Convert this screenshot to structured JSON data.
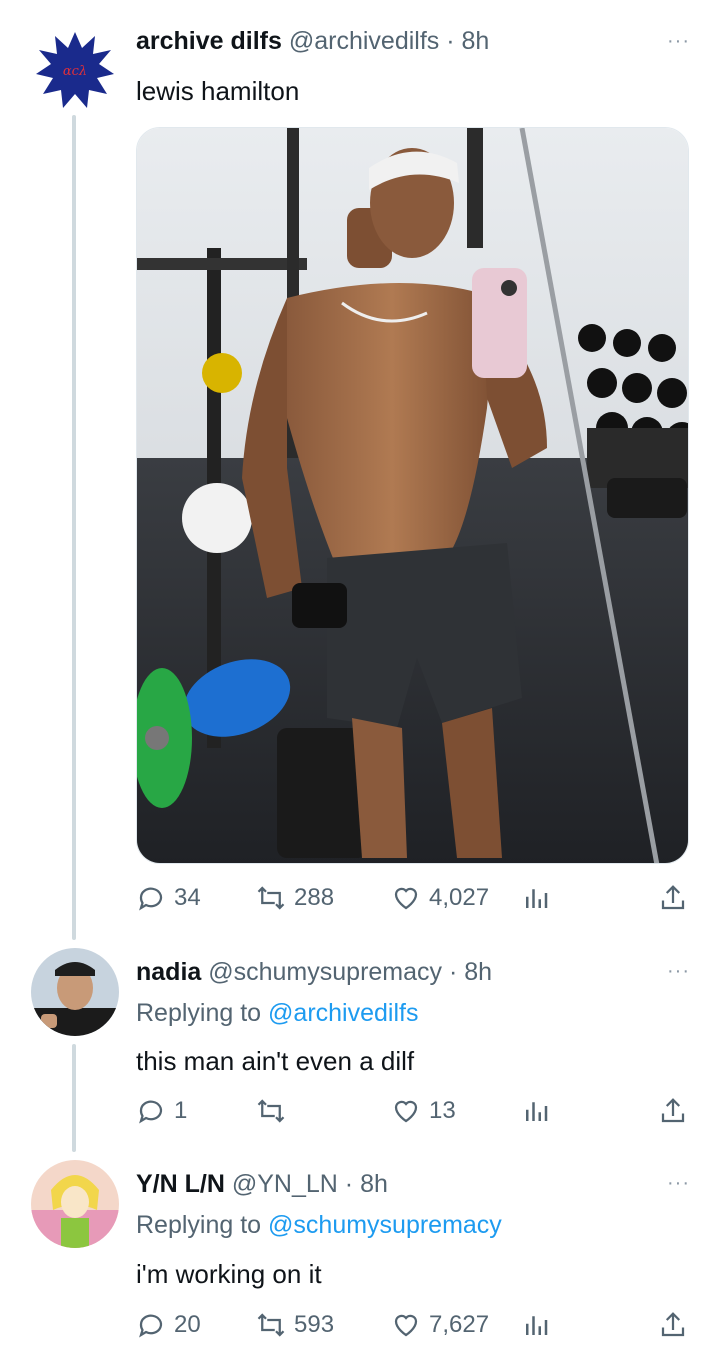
{
  "tweets": [
    {
      "name": "archive dilfs",
      "handle": "@archivedilfs",
      "time": "· 8h",
      "text": "lewis hamilton",
      "replies": "34",
      "retweets": "288",
      "likes": "4,027",
      "avatar_icon": "starburst-logo-icon",
      "media_alt": "gym mirror selfie"
    },
    {
      "name": "nadia",
      "handle": "@schumysupremacy",
      "time": "· 8h",
      "replying_prefix": "Replying to",
      "replying_to": "@archivedilfs",
      "text": "this man ain't even a dilf",
      "replies": "1",
      "retweets": "",
      "likes": "13"
    },
    {
      "name": "Y/N L/N",
      "handle": "@YN_LN",
      "time": "· 8h",
      "replying_prefix": "Replying to",
      "replying_to": "@schumysupremacy",
      "text": "i'm working on it",
      "replies": "20",
      "retweets": "593",
      "likes": "7,627"
    }
  ],
  "more_label": "···",
  "colors": {
    "text": "#0f1419",
    "secondary": "#536471",
    "link": "#1d9bf0",
    "thread_line": "#cfd9de"
  }
}
